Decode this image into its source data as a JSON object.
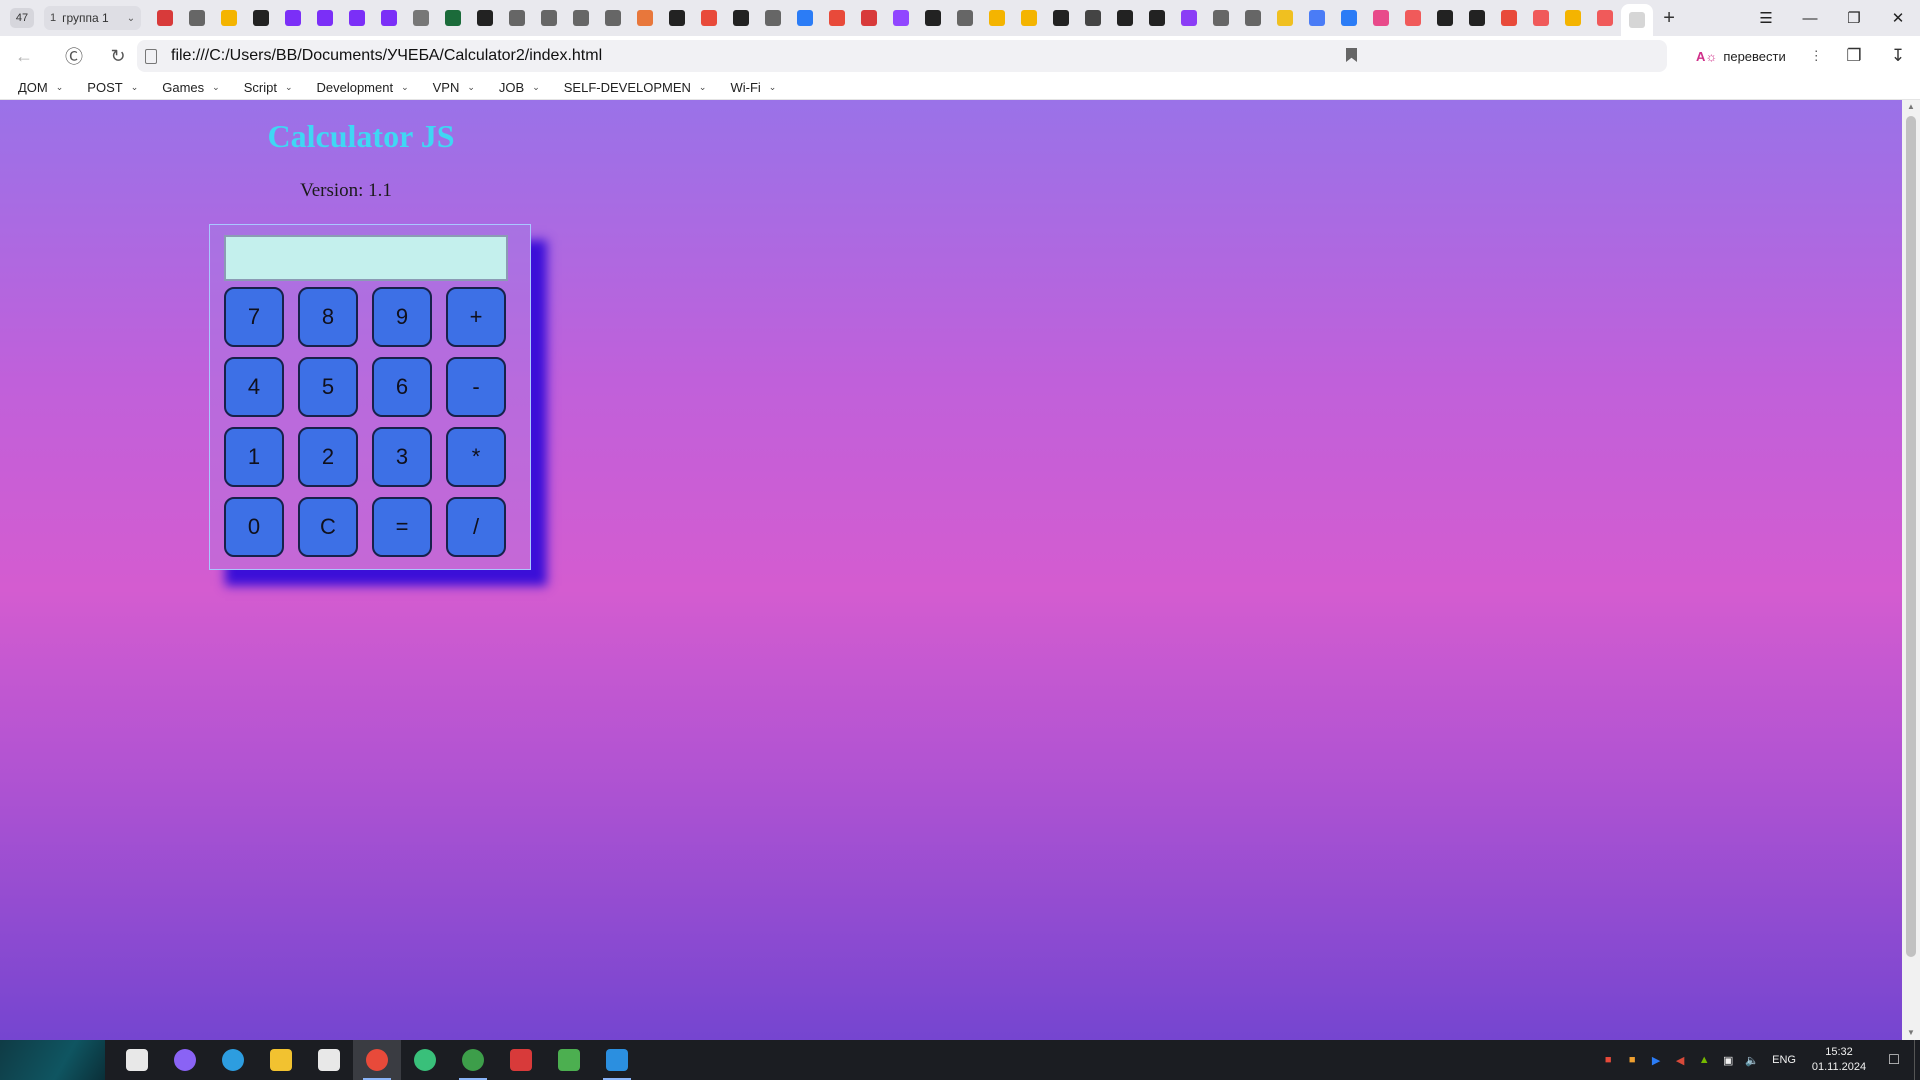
{
  "browser": {
    "tab_count": "47",
    "tab_group": {
      "number": "1",
      "name": "группа 1"
    },
    "favicons": [
      "#d83a3a",
      "#666666",
      "#f4b400",
      "#222222",
      "#7b2ff7",
      "#7b2ff7",
      "#7b2ff7",
      "#7b2ff7",
      "#777777",
      "#1b6b3a",
      "#222222",
      "#666666",
      "#666666",
      "#666666",
      "#666666",
      "#e8773b",
      "#222222",
      "#e84a3a",
      "#222222",
      "#666666",
      "#2b7cf6",
      "#e84a3a",
      "#d83a3a",
      "#9146ff",
      "#222222",
      "#666666",
      "#f4b400",
      "#f4b400",
      "#222222",
      "#444444",
      "#222222",
      "#222222",
      "#8b3df6",
      "#666666",
      "#666666",
      "#f0c020",
      "#4a7cf6",
      "#2b7cf6",
      "#e84a8a",
      "#f05a5a",
      "#222222",
      "#222222",
      "#e84a3a",
      "#f05a5a",
      "#f4b400",
      "#f05a5a",
      "#ffffff"
    ],
    "url": "file:///C:/Users/BB/Documents/УЧЕБА/Calculator2/index.html",
    "translate_label": "перевести"
  },
  "bookmarks": [
    "ДОМ",
    "POST",
    "Games",
    "Script",
    "Development",
    "VPN",
    "JOB",
    "SELF-DEVELOPMEN",
    "Wi-Fi"
  ],
  "page": {
    "title": "Calculator JS",
    "version": "Version: 1.1",
    "display_value": "",
    "buttons": [
      "7",
      "8",
      "9",
      "+",
      "4",
      "5",
      "6",
      "-",
      "1",
      "2",
      "3",
      "*",
      "0",
      "C",
      "=",
      "/"
    ],
    "colors": {
      "title": "#3fd7f4",
      "button": "#3d70e6",
      "display": "#c4f0ed",
      "shadow": "#3b0fd8"
    }
  },
  "taskbar": {
    "apps": [
      {
        "name": "task-view-icon",
        "color": "#e8e8e8"
      },
      {
        "name": "alice-icon",
        "color": "#8a63f5"
      },
      {
        "name": "edge-icon",
        "color": "#2d9de0"
      },
      {
        "name": "file-explorer-icon",
        "color": "#f2c230"
      },
      {
        "name": "store-icon",
        "color": "#e8e8e8"
      },
      {
        "name": "yandex-browser-icon",
        "color": "#e84a3a"
      },
      {
        "name": "upwork-icon",
        "color": "#39c07a"
      },
      {
        "name": "chrome-icon",
        "color": "#3d9e4a"
      },
      {
        "name": "app-red-icon",
        "color": "#d83a3a"
      },
      {
        "name": "app-green-icon",
        "color": "#4caf50"
      },
      {
        "name": "vscode-icon",
        "color": "#2b8fe0"
      }
    ],
    "lang": "ENG",
    "time": "15:32",
    "date": "01.11.2024"
  }
}
